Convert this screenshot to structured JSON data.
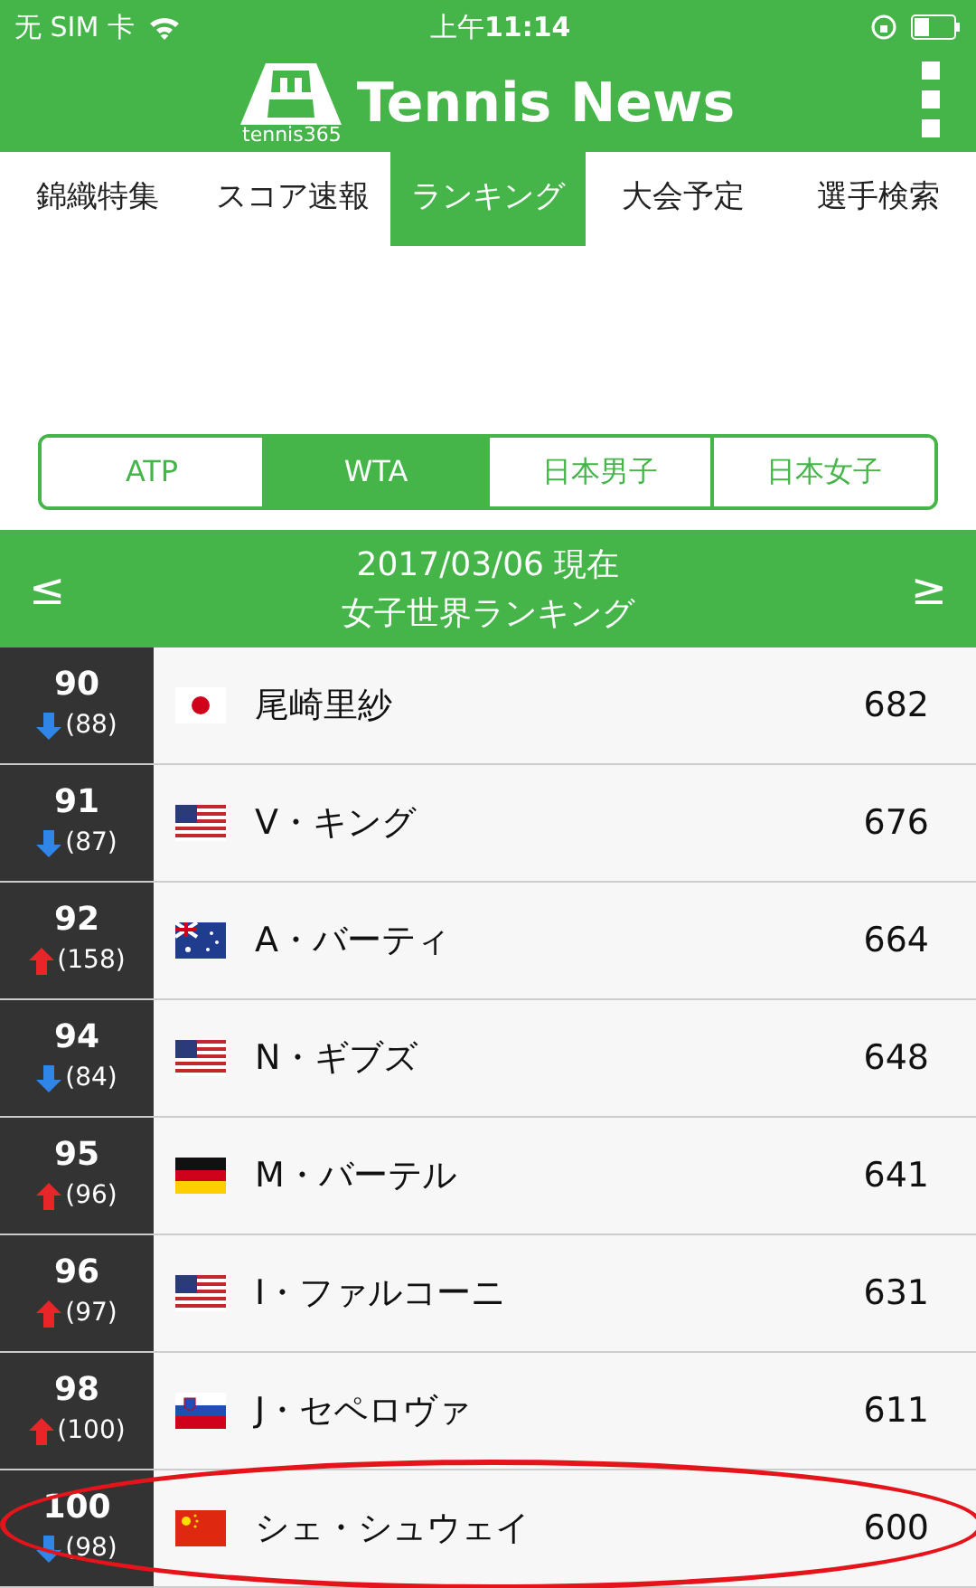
{
  "status_bar": {
    "carrier": "无 SIM 卡",
    "time_prefix": "上午",
    "time": "11:14"
  },
  "header": {
    "logo_text": "tennis365",
    "title": "Tennis News"
  },
  "tabs": [
    {
      "label": "錦織特集",
      "selected": false
    },
    {
      "label": "スコア速報",
      "selected": false
    },
    {
      "label": "ランキング",
      "selected": true
    },
    {
      "label": "大会予定",
      "selected": false
    },
    {
      "label": "選手検索",
      "selected": false
    }
  ],
  "segments": [
    {
      "label": "ATP",
      "selected": false
    },
    {
      "label": "WTA",
      "selected": true
    },
    {
      "label": "日本男子",
      "selected": false
    },
    {
      "label": "日本女子",
      "selected": false
    }
  ],
  "ranking_header": {
    "prev": "≤",
    "date": "2017/03/06 現在",
    "title": "女子世界ランキング",
    "next": "≥"
  },
  "rows": [
    {
      "rank": "90",
      "previous": "(88)",
      "rank_up": false,
      "flag": {
        "kind": "jp"
      },
      "name": "尾崎里紗",
      "points": "682",
      "circled": false
    },
    {
      "rank": "91",
      "previous": "(87)",
      "rank_up": false,
      "flag": {
        "kind": "us"
      },
      "name": "V・キング",
      "points": "676",
      "circled": false
    },
    {
      "rank": "92",
      "previous": "(158)",
      "rank_up": true,
      "flag": {
        "kind": "au"
      },
      "name": "A・バーティ",
      "points": "664",
      "circled": false
    },
    {
      "rank": "94",
      "previous": "(84)",
      "rank_up": false,
      "flag": {
        "kind": "us"
      },
      "name": "N・ギブズ",
      "points": "648",
      "circled": false
    },
    {
      "rank": "95",
      "previous": "(96)",
      "rank_up": true,
      "flag": {
        "kind": "de"
      },
      "name": "M・バーテル",
      "points": "641",
      "circled": false
    },
    {
      "rank": "96",
      "previous": "(97)",
      "rank_up": true,
      "flag": {
        "kind": "us"
      },
      "name": "I・ファルコーニ",
      "points": "631",
      "circled": false
    },
    {
      "rank": "98",
      "previous": "(100)",
      "rank_up": true,
      "flag": {
        "kind": "si"
      },
      "name": "J・セペロヴァ",
      "points": "611",
      "circled": false
    },
    {
      "rank": "100",
      "previous": "(98)",
      "rank_up": false,
      "flag": {
        "kind": "cn"
      },
      "name": "シェ・シュウェイ",
      "points": "600",
      "circled": true
    }
  ]
}
